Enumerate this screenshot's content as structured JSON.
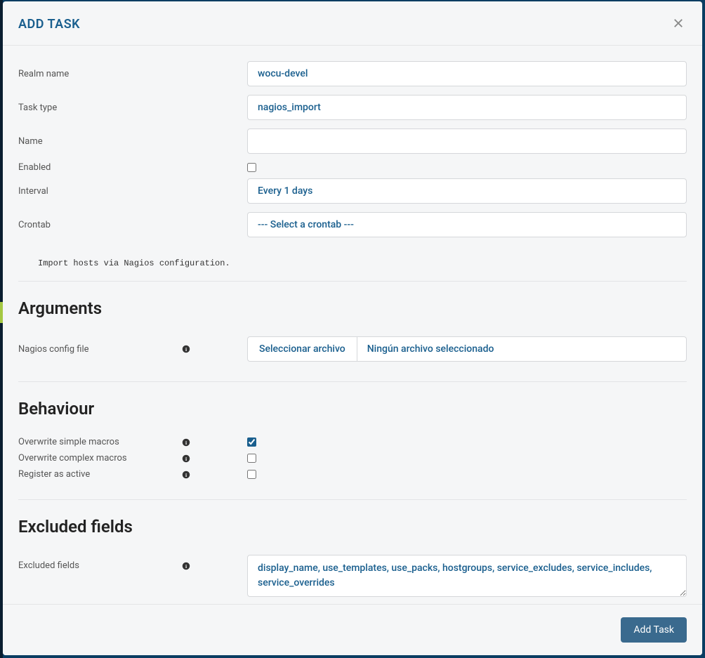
{
  "modal": {
    "title": "ADD TASK",
    "fields": {
      "realm_name": {
        "label": "Realm name",
        "value": "wocu-devel"
      },
      "task_type": {
        "label": "Task type",
        "value": "nagios_import"
      },
      "name": {
        "label": "Name",
        "value": ""
      },
      "enabled": {
        "label": "Enabled",
        "checked": false
      },
      "interval": {
        "label": "Interval",
        "value": "Every 1 days"
      },
      "crontab": {
        "label": "Crontab",
        "value": "--- Select a crontab ---"
      }
    },
    "description": "Import hosts via Nagios configuration.",
    "sections": {
      "arguments": {
        "heading": "Arguments",
        "nagios_config_file": {
          "label": "Nagios config file",
          "button_label": "Seleccionar archivo",
          "no_file_text": "Ningún archivo seleccionado"
        }
      },
      "behaviour": {
        "heading": "Behaviour",
        "overwrite_simple": {
          "label": "Overwrite simple macros",
          "checked": true
        },
        "overwrite_complex": {
          "label": "Overwrite complex macros",
          "checked": false
        },
        "register_active": {
          "label": "Register as active",
          "checked": false
        }
      },
      "excluded_fields": {
        "heading": "Excluded fields",
        "field": {
          "label": "Excluded fields",
          "value": "display_name, use_templates, use_packs, hostgroups, service_excludes, service_includes, service_overrides"
        }
      }
    },
    "footer": {
      "add_task_button": "Add Task"
    }
  }
}
